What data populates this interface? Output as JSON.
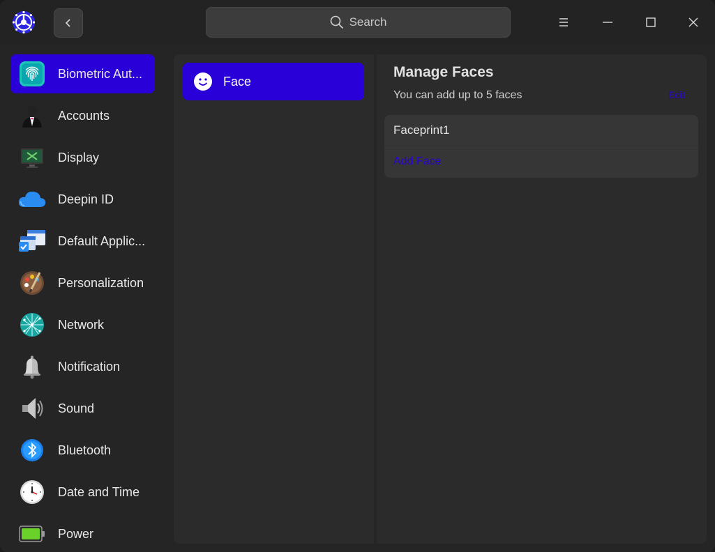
{
  "titlebar": {
    "search_placeholder": "Search"
  },
  "sidebar": {
    "items": [
      {
        "label": "Biometric Aut...",
        "icon": "fingerprint-icon",
        "active": true
      },
      {
        "label": "Accounts",
        "icon": "accounts-icon"
      },
      {
        "label": "Display",
        "icon": "display-icon"
      },
      {
        "label": "Deepin ID",
        "icon": "cloud-icon"
      },
      {
        "label": "Default Applic...",
        "icon": "default-apps-icon"
      },
      {
        "label": "Personalization",
        "icon": "palette-icon"
      },
      {
        "label": "Network",
        "icon": "network-icon"
      },
      {
        "label": "Notification",
        "icon": "bell-icon"
      },
      {
        "label": "Sound",
        "icon": "speaker-icon"
      },
      {
        "label": "Bluetooth",
        "icon": "bluetooth-icon"
      },
      {
        "label": "Date and Time",
        "icon": "clock-icon"
      },
      {
        "label": "Power",
        "icon": "battery-icon"
      }
    ]
  },
  "middle": {
    "items": [
      {
        "label": "Face",
        "icon": "smiley-icon",
        "active": true
      }
    ]
  },
  "main": {
    "title": "Manage Faces",
    "subtitle": "You can add up to 5 faces",
    "edit_label": "Edit",
    "faces": [
      "Faceprint1"
    ],
    "add_label": "Add Face"
  },
  "colors": {
    "accent": "#2a00d8",
    "background": "#252525",
    "panel": "#2b2b2b",
    "card": "#363636"
  }
}
